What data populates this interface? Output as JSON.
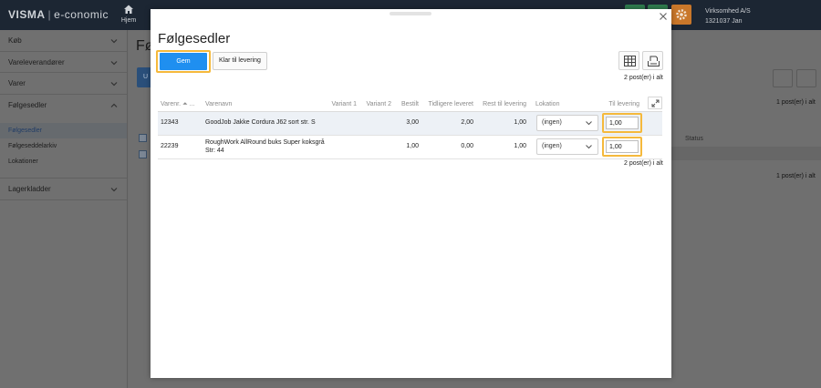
{
  "app": {
    "logo_brand": "VISMA",
    "logo_product": "e-conomic",
    "home_label": "Hjem",
    "company_name": "Virksomhed A/S",
    "company_id": "1321037 Jan",
    "colors": {
      "topbar": "#1c2633",
      "accent_green": "#2f7d4e",
      "accent_orange": "#c9772a",
      "primary_blue": "#1f8ff0",
      "highlight": "#f5b93c"
    }
  },
  "sidebar": {
    "items": [
      {
        "label": "Køb",
        "icon": "chevron-down-icon"
      },
      {
        "label": "Vareleverandører",
        "icon": "chevron-down-icon"
      },
      {
        "label": "Varer",
        "icon": "chevron-down-icon"
      },
      {
        "label": "Følgesedler",
        "icon": "chevron-up-icon"
      }
    ],
    "subitems": [
      {
        "label": "Følgesedler",
        "active": true
      },
      {
        "label": "Følgeseddelarkiv",
        "active": false
      },
      {
        "label": "Lokationer",
        "active": false
      }
    ],
    "bottom_item": {
      "label": "Lagerkladder",
      "icon": "chevron-down-icon"
    }
  },
  "background": {
    "page_title": "Fø",
    "button_prefix": "U",
    "count_top": "1 post(er) i alt",
    "count_bottom": "1 post(er) i alt",
    "status_header": "Status"
  },
  "modal": {
    "title": "Følgesedler",
    "save_label": "Gem",
    "ready_label": "Klar til levering",
    "count_top": "2 post(er) i alt",
    "count_bottom": "2 post(er) i alt",
    "columns": {
      "item_no": "Varenr. ⏶ ...",
      "item_name": "Varenavn",
      "variant1": "Variant 1",
      "variant2": "Variant 2",
      "ordered": "Bestilt",
      "previously_delivered": "Tidligere leveret",
      "remaining": "Rest til levering",
      "location": "Lokation",
      "to_deliver": "Til levering"
    },
    "rows": [
      {
        "item_no": "12343",
        "name_line1": "GoodJob Jakke Cordura J62 sort str. S",
        "name_line2": "",
        "ordered": "3,00",
        "previously_delivered": "2,00",
        "remaining": "1,00",
        "location": "(ingen)",
        "to_deliver": "1,00"
      },
      {
        "item_no": "22239",
        "name_line1": "RoughWork AllRound buks Super koksgrå",
        "name_line2": "Str: 44",
        "ordered": "1,00",
        "previously_delivered": "0,00",
        "remaining": "1,00",
        "location": "(ingen)",
        "to_deliver": "1,00"
      }
    ]
  }
}
